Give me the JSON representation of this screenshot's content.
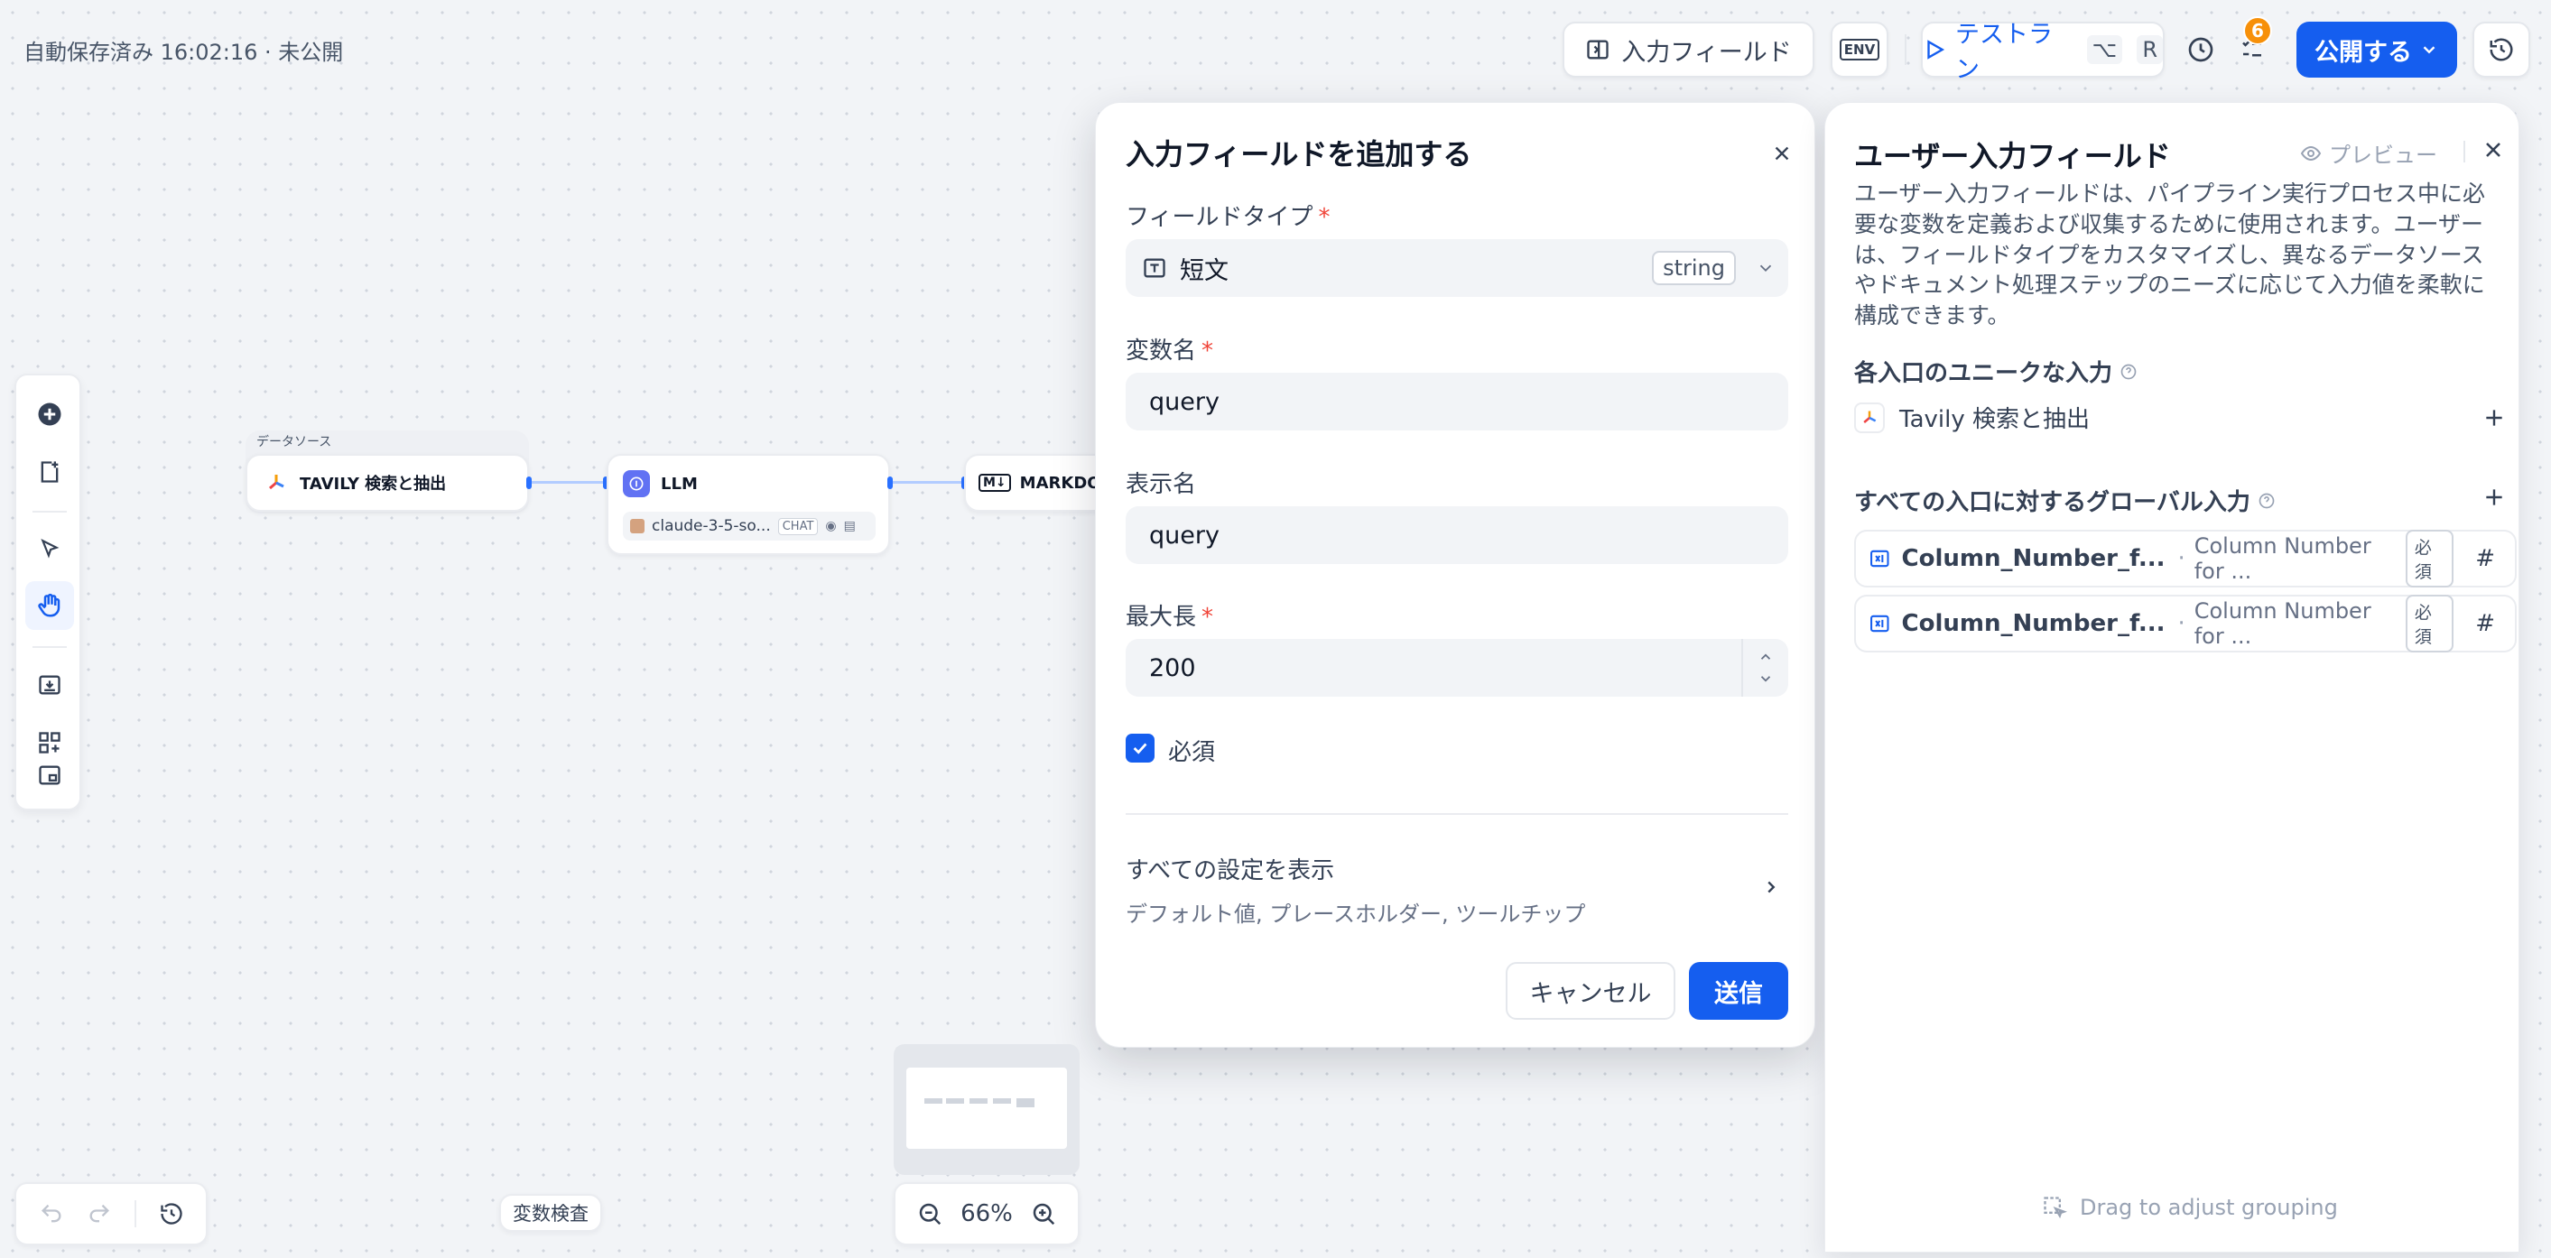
{
  "topbar": {
    "autosave": "自動保存済み 16:02:16 · 未公開",
    "input_field_btn": "入力フィールド",
    "env_label": "ENV",
    "test_run": "テストラン",
    "test_run_kbd1": "⌥",
    "test_run_kbd2": "R",
    "checklist_badge": "6",
    "publish": "公開する"
  },
  "canvas": {
    "datasource_caption": "データソース",
    "node_tavily": "TAVILY 検索と抽出",
    "node_llm": "LLM",
    "llm_model": "claude-3-5-so...",
    "llm_mode": "CHAT",
    "node_markdown": "MARKDOW",
    "zoom": "66%",
    "var_inspect": "変数検査"
  },
  "modal": {
    "title": "入力フィールドを追加する",
    "field_type_label": "フィールドタイプ",
    "field_type_value": "短文",
    "field_type_tag": "string",
    "var_name_label": "変数名",
    "var_name_value": "query",
    "display_name_label": "表示名",
    "display_name_value": "query",
    "max_length_label": "最大長",
    "max_length_value": "200",
    "required_label": "必須",
    "show_all_settings": "すべての設定を表示",
    "show_all_settings_sub": "デフォルト値, プレースホルダー, ツールチップ",
    "cancel": "キャンセル",
    "submit": "送信"
  },
  "panel": {
    "title": "ユーザー入力フィールド",
    "preview": "プレビュー",
    "description": "ユーザー入力フィールドは、パイプライン実行プロセス中に必要な変数を定義および収集するために使用されます。ユーザーは、フィールドタイプをカスタマイズし、異なるデータソースやドキュメント処理ステップのニーズに応じて入力値を柔軟に構成できます。",
    "unique_section": "各入口のユニークな入力",
    "unique_item": "Tavily 検索と抽出",
    "global_section": "すべての入口に対するグローバル入力",
    "global_items": [
      {
        "name": "Column_Number_f...",
        "label": "Column Number for ...",
        "required": "必須",
        "type_symbol": "#"
      },
      {
        "name": "Column_Number_f...",
        "label": "Column Number for ...",
        "required": "必須",
        "type_symbol": "#"
      }
    ],
    "drag_hint": "Drag to adjust grouping"
  },
  "colors": {
    "accent": "#155eef",
    "required": "#f04438",
    "badge": "#f79009"
  }
}
